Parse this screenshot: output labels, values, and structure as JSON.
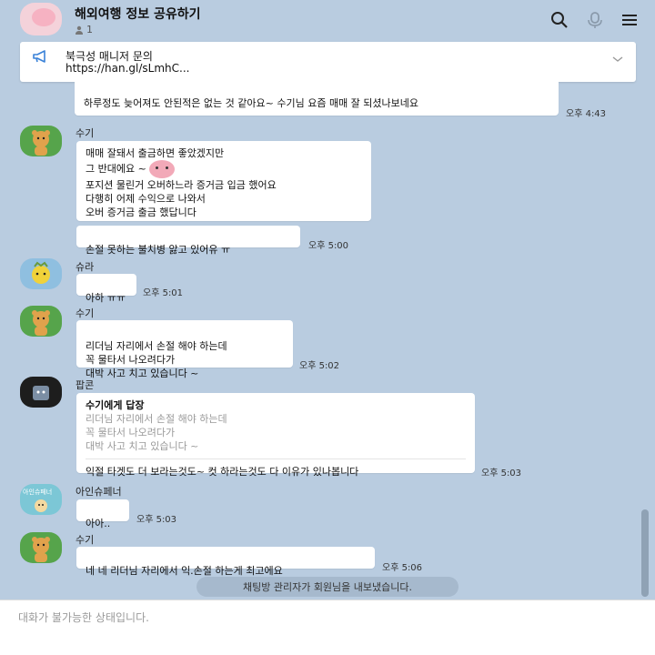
{
  "header": {
    "title": "해외여행 정보 공유하기",
    "member_count": "1",
    "icons": [
      "search-icon",
      "call-icon",
      "menu-icon"
    ]
  },
  "notice": {
    "title": "북극성 매니저 문의",
    "link": "https://han.gl/sLmhC..."
  },
  "messages": [
    {
      "sender": "",
      "text": "하루정도 늦어져도 안된적은 없는 것 같아요~ 수기님 요즘 매매 잘 되셨나보네요",
      "time": "오후 4:43"
    },
    {
      "sender": "수기",
      "lines": [
        "매매 잘돼서 출금하면 좋았겠지만",
        "그 반대에요 ~",
        "포지션 물린거 오버하느라 증거금  입금 했어요",
        "다행히 어제 수익으로 나와서",
        "오버 증거금 출금 했답니다"
      ],
      "followup": "손절 못하는 불치병 앓고 있어유 ㅠ",
      "time": "오후 5:00"
    },
    {
      "sender": "슈라",
      "text": "아하 ㅠㅠ",
      "time": "오후 5:01"
    },
    {
      "sender": "수기",
      "text": "리더님 자리에서 손절 해야 하는데\n꼭 물타서 나오려다가\n대박 사고 치고 있습니다 ~",
      "time": "오후 5:02"
    },
    {
      "sender": "팝콘",
      "reply_to": "수기에게 답장",
      "quote": "리더님 자리에서 손절 해야 하는데\n꼭 물타서 나오려다가\n대박 사고 치고 있습니다 ~",
      "text": "익절 타겟도 더 보라는것도~ 컷 하라는것도 다 이유가 있나봅니다",
      "time": "오후 5:03"
    },
    {
      "sender": "아인슈페너",
      "avatar_label": "아인슈페너",
      "text": "아아..",
      "time": "오후 5:03"
    },
    {
      "sender": "수기",
      "text": "네 네 리더님 자리에서 익.손절 하는게  최고에요",
      "time": "오후 5:06"
    }
  ],
  "system_message": "채팅방 관리자가 회원님을 내보냈습니다.",
  "input": {
    "placeholder": "대화가 불가능한 상태입니다."
  },
  "colors": {
    "background": "#b9cce0",
    "bubble": "#ffffff",
    "system_pill": "#a6b9cd"
  }
}
